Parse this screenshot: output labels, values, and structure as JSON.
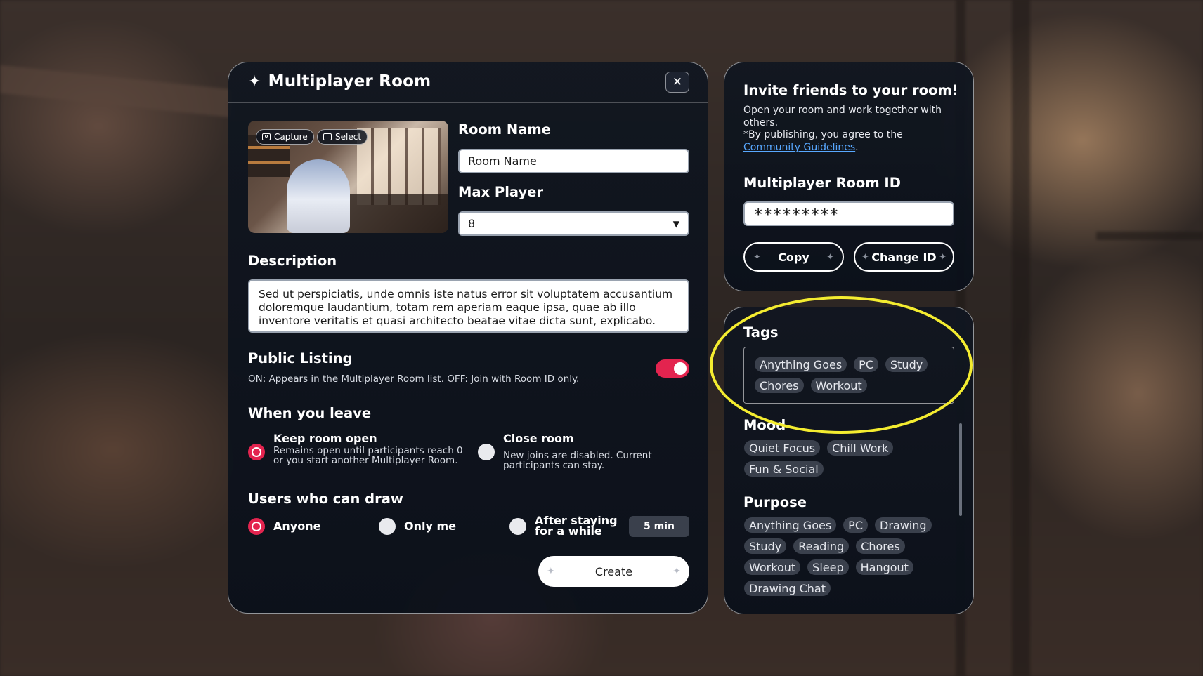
{
  "main": {
    "title": "Multiplayer Room",
    "capture_label": "Capture",
    "select_label": "Select",
    "room_name_label": "Room Name",
    "room_name_value": "Room Name",
    "max_player_label": "Max Player",
    "max_player_value": "8",
    "description_label": "Description",
    "description_value": "Sed ut perspiciatis, unde omnis iste natus error sit voluptatem accusantium doloremque laudantium, totam rem aperiam eaque ipsa, quae ab illo inventore veritatis et quasi architecto beatae vitae dicta sunt, explicabo.",
    "public_listing_label": "Public Listing",
    "public_listing_desc": "ON: Appears in the Multiplayer Room list. OFF: Join with Room ID only.",
    "public_listing_on": true,
    "when_leave_label": "When you leave",
    "keep_open_title": "Keep room open",
    "keep_open_desc": "Remains open until participants reach 0 or you start another Multiplayer Room.",
    "close_room_title": "Close room",
    "close_room_desc": "New joins are disabled. Current participants can stay.",
    "draw_label": "Users who can draw",
    "draw_anyone": "Anyone",
    "draw_only_me": "Only me",
    "draw_after_stay": "After staying for a while",
    "stay_minutes": "5 min",
    "create_label": "Create"
  },
  "invite": {
    "title": "Invite friends to your room!",
    "desc": "Open your room and work together with others.",
    "agree_prefix": "*By publishing, you agree to the ",
    "guidelines_link": "Community Guidelines",
    "agree_suffix": ".",
    "room_id_label": "Multiplayer Room ID",
    "room_id_value": "*********",
    "copy_label": "Copy",
    "change_id_label": "Change ID"
  },
  "tags_panel": {
    "tags_label": "Tags",
    "selected_tags": [
      "Anything Goes",
      "PC",
      "Study",
      "Chores",
      "Workout"
    ],
    "mood_label": "Mood",
    "mood_tags": [
      "Quiet Focus",
      "Chill Work",
      "Fun & Social"
    ],
    "purpose_label": "Purpose",
    "purpose_tags": [
      "Anything Goes",
      "PC",
      "Drawing",
      "Study",
      "Reading",
      "Chores",
      "Workout",
      "Sleep",
      "Hangout",
      "Drawing Chat"
    ]
  },
  "colors": {
    "accent": "#e3244f",
    "highlight": "#f4ec30",
    "link": "#58a8ff"
  }
}
